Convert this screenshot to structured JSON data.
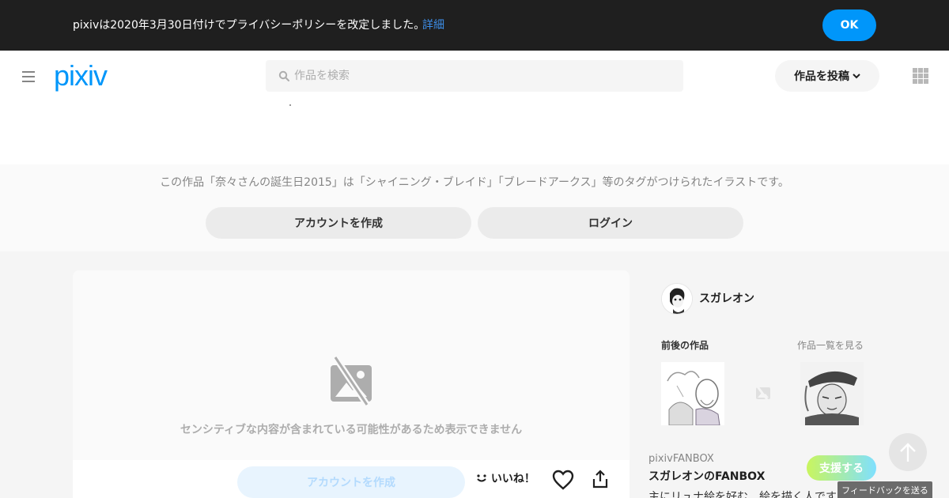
{
  "policy": {
    "message": "pixivは2020年3月30日付けでプライバシーポリシーを改定しました。",
    "details_link": "詳細",
    "ok_label": "OK"
  },
  "header": {
    "logo": "pixiv",
    "search_placeholder": "作品を検索",
    "post_label": "作品を投稿",
    "menu_icon": "hamburger-icon",
    "apps_icon": "grid-icon"
  },
  "banner": {
    "description": "この作品「奈々さんの誕生日2015」は「シャイニング・ブレイド」「ブレードアークス」等のタグがつけられたイラストです。",
    "create_account": "アカウントを作成",
    "login": "ログイン"
  },
  "artwork": {
    "blocked_message": "センシティブな内容が含まれている可能性があるため表示できません",
    "create_account": "アカウントを作成",
    "like_label": "いいね！"
  },
  "sidebar": {
    "user_name": "スガレオン",
    "works_heading": "前後の作品",
    "works_all_link": "作品一覧を見る",
    "fanbox_label": "pixivFANBOX",
    "fanbox_name": "スガレオンのFANBOX",
    "fanbox_desc": "主にリュナ絵を好む、絵を描く人です",
    "support_label": "支援する"
  },
  "feedback_label": "フィードバックを送る",
  "colors": {
    "brand": "#0096fa",
    "policy_bg": "#1f1f1f"
  }
}
